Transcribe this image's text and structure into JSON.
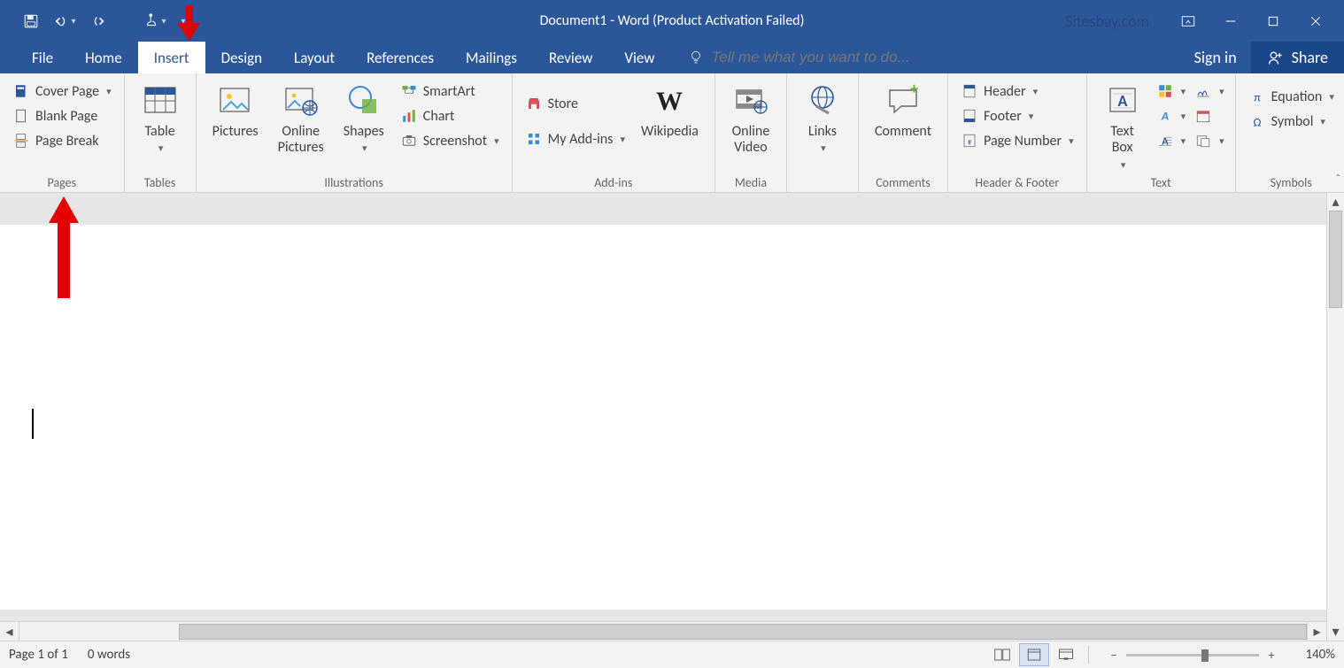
{
  "titlebar": {
    "title": "Document1 - Word (Product Activation Failed)",
    "watermark": "Sitesbay.com"
  },
  "tabs": {
    "file": "File",
    "home": "Home",
    "insert": "Insert",
    "design": "Design",
    "layout": "Layout",
    "references": "References",
    "mailings": "Mailings",
    "review": "Review",
    "view": "View",
    "tellme": "Tell me what you want to do...",
    "signin": "Sign in",
    "share": "Share"
  },
  "ribbon": {
    "pages": {
      "label": "Pages",
      "cover": "Cover Page",
      "blank": "Blank Page",
      "break": "Page Break"
    },
    "tables": {
      "label": "Tables",
      "table": "Table"
    },
    "illus": {
      "label": "Illustrations",
      "pictures": "Pictures",
      "online": "Online Pictures",
      "shapes": "Shapes",
      "smartart": "SmartArt",
      "chart": "Chart",
      "screenshot": "Screenshot"
    },
    "addins": {
      "label": "Add-ins",
      "store": "Store",
      "myaddins": "My Add-ins",
      "wikipedia": "Wikipedia"
    },
    "media": {
      "label": "Media",
      "video": "Online Video"
    },
    "links": {
      "label": "",
      "links": "Links"
    },
    "comments": {
      "label": "Comments",
      "comment": "Comment"
    },
    "headerfooter": {
      "label": "Header & Footer",
      "header": "Header",
      "footer": "Footer",
      "pagenum": "Page Number"
    },
    "text": {
      "label": "Text",
      "textbox": "Text Box"
    },
    "symbols": {
      "label": "Symbols",
      "equation": "Equation",
      "symbol": "Symbol"
    }
  },
  "status": {
    "page": "Page 1 of 1",
    "words": "0 words",
    "zoom": "140%"
  }
}
